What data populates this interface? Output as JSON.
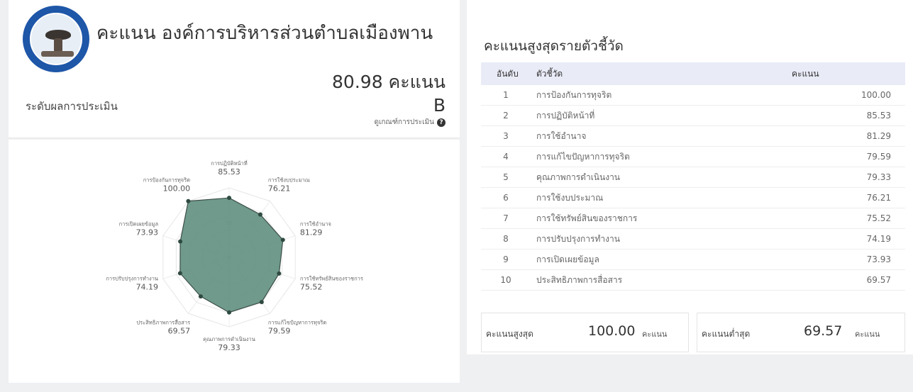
{
  "header": {
    "org_title": "คะแนน องค์การบริหารส่วนตำบลเมืองพาน",
    "score": "80.98 คะแนน",
    "level_label": "ระดับผลการประเมิน",
    "level_value": "B",
    "criteria_link": "ดูเกณฑ์การประเมิน",
    "help_icon": "?"
  },
  "chart_data": {
    "type": "radar",
    "range": [
      0,
      100
    ],
    "grid": true,
    "tick_labels": [
      "0",
      "50"
    ],
    "axes": [
      {
        "label": "การปฏิบัติหน้าที่",
        "value": 85.53,
        "value_text": "85.53"
      },
      {
        "label": "การใช้งบประมาณ",
        "value": 76.21,
        "value_text": "76.21"
      },
      {
        "label": "การใช้อำนาจ",
        "value": 81.29,
        "value_text": "81.29"
      },
      {
        "label": "การใช้ทรัพย์สินของราชการ",
        "value": 75.52,
        "value_text": "75.52"
      },
      {
        "label": "การแก้ไขปัญหาการทุจริต",
        "value": 79.59,
        "value_text": "79.59"
      },
      {
        "label": "คุณภาพการดำเนินงาน",
        "value": 79.33,
        "value_text": "79.33"
      },
      {
        "label": "ประสิทธิภาพการสื่อสาร",
        "value": 69.57,
        "value_text": "69.57"
      },
      {
        "label": "การปรับปรุงการทำงาน",
        "value": 74.19,
        "value_text": "74.19"
      },
      {
        "label": "การเปิดเผยข้อมูล",
        "value": 73.93,
        "value_text": "73.93"
      },
      {
        "label": "การป้องกันการทุจริต",
        "value": 100.0,
        "value_text": "100.00"
      }
    ],
    "fill_color": "#5f8f7f",
    "stroke_color": "#3d4f49"
  },
  "ranking": {
    "title": "คะแนนสูงสุดรายตัวชี้วัด",
    "headers": {
      "rank": "อันดับ",
      "indicator": "ตัวชี้วัด",
      "score": "คะแนน"
    },
    "rows": [
      {
        "rank": "1",
        "name": "การป้องกันการทุจริต",
        "score": "100.00"
      },
      {
        "rank": "2",
        "name": "การปฏิบัติหน้าที่",
        "score": "85.53"
      },
      {
        "rank": "3",
        "name": "การใช้อำนาจ",
        "score": "81.29"
      },
      {
        "rank": "4",
        "name": "การแก้ไขปัญหาการทุจริต",
        "score": "79.59"
      },
      {
        "rank": "5",
        "name": "คุณภาพการดำเนินงาน",
        "score": "79.33"
      },
      {
        "rank": "6",
        "name": "การใช้งบประมาณ",
        "score": "76.21"
      },
      {
        "rank": "7",
        "name": "การใช้ทรัพย์สินของราชการ",
        "score": "75.52"
      },
      {
        "rank": "8",
        "name": "การปรับปรุงการทำงาน",
        "score": "74.19"
      },
      {
        "rank": "9",
        "name": "การเปิดเผยข้อมูล",
        "score": "73.93"
      },
      {
        "rank": "10",
        "name": "ประสิทธิภาพการสื่อสาร",
        "score": "69.57"
      }
    ]
  },
  "summary": {
    "max_label": "คะแนนสูงสุด",
    "max_value": "100.00",
    "min_label": "คะแนนต่ำสุด",
    "min_value": "69.57",
    "unit": "คะแนน"
  }
}
